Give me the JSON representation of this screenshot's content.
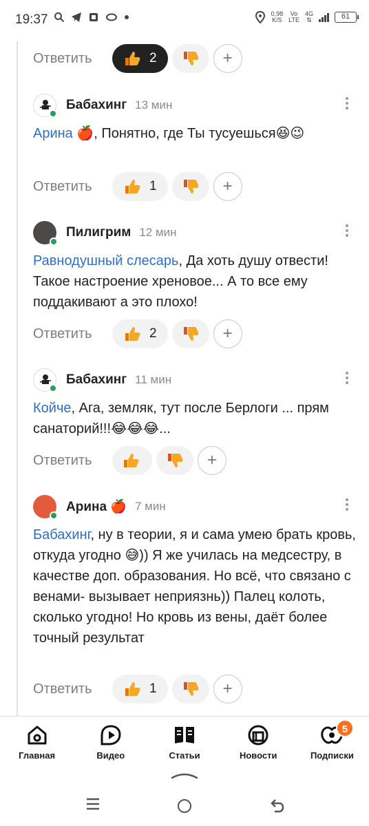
{
  "status_bar": {
    "time": "19:37",
    "speed_value": "0,98",
    "speed_unit": "K/S",
    "vo": "Vo",
    "lte": "LTE",
    "net": "4G",
    "battery": "61"
  },
  "comments": [
    {
      "actions": {
        "reply": "Ответить",
        "likes": "2",
        "liked": true
      }
    },
    {
      "author": "Бабахинг",
      "time": "13 мин",
      "mention": "Арина 🍎",
      "text": ", Понятно, где Ты тусуешься😆😉",
      "actions": {
        "reply": "Ответить",
        "likes": "1"
      }
    },
    {
      "author": "Пилигрим",
      "time": "12 мин",
      "mention": "Равнодушный слесарь",
      "text": ", Да хоть душу отвести! Такое настроение хреновое... А то все ему поддакивают а это плохо!",
      "actions": {
        "reply": "Ответить",
        "likes": "2"
      }
    },
    {
      "author": "Бабахинг",
      "time": "11 мин",
      "mention": "Койче",
      "text": ", Ага, земляк, тут после Берлоги ... прям санаторий!!!😂😂😂...",
      "actions": {
        "reply": "Ответить",
        "likes": ""
      }
    },
    {
      "author": "Арина 🍎",
      "time": "7 мин",
      "mention": "Бабахинг",
      "text": ", ну в теории, я и сама умею брать кровь, откуда угодно 😅)) Я же училась на медсестру, в качестве доп. образования. Но всё, что связано с венами- вызывает неприязнь)) Палец колоть, сколько угодно! Но кровь из вены, даёт более точный результат",
      "actions": {
        "reply": "Ответить",
        "likes": "1"
      }
    }
  ],
  "bottom_nav": {
    "items": [
      {
        "label": "Главная",
        "icon": "home-icon"
      },
      {
        "label": "Видео",
        "icon": "video-icon"
      },
      {
        "label": "Статьи",
        "icon": "articles-icon"
      },
      {
        "label": "Новости",
        "icon": "news-icon"
      },
      {
        "label": "Подписки",
        "icon": "subscriptions-icon",
        "badge": "5"
      }
    ]
  },
  "colors": {
    "mention": "#2e6fca",
    "online": "#2a9d5c",
    "badge": "#ff6d1f",
    "thumb": "#f5a623"
  }
}
